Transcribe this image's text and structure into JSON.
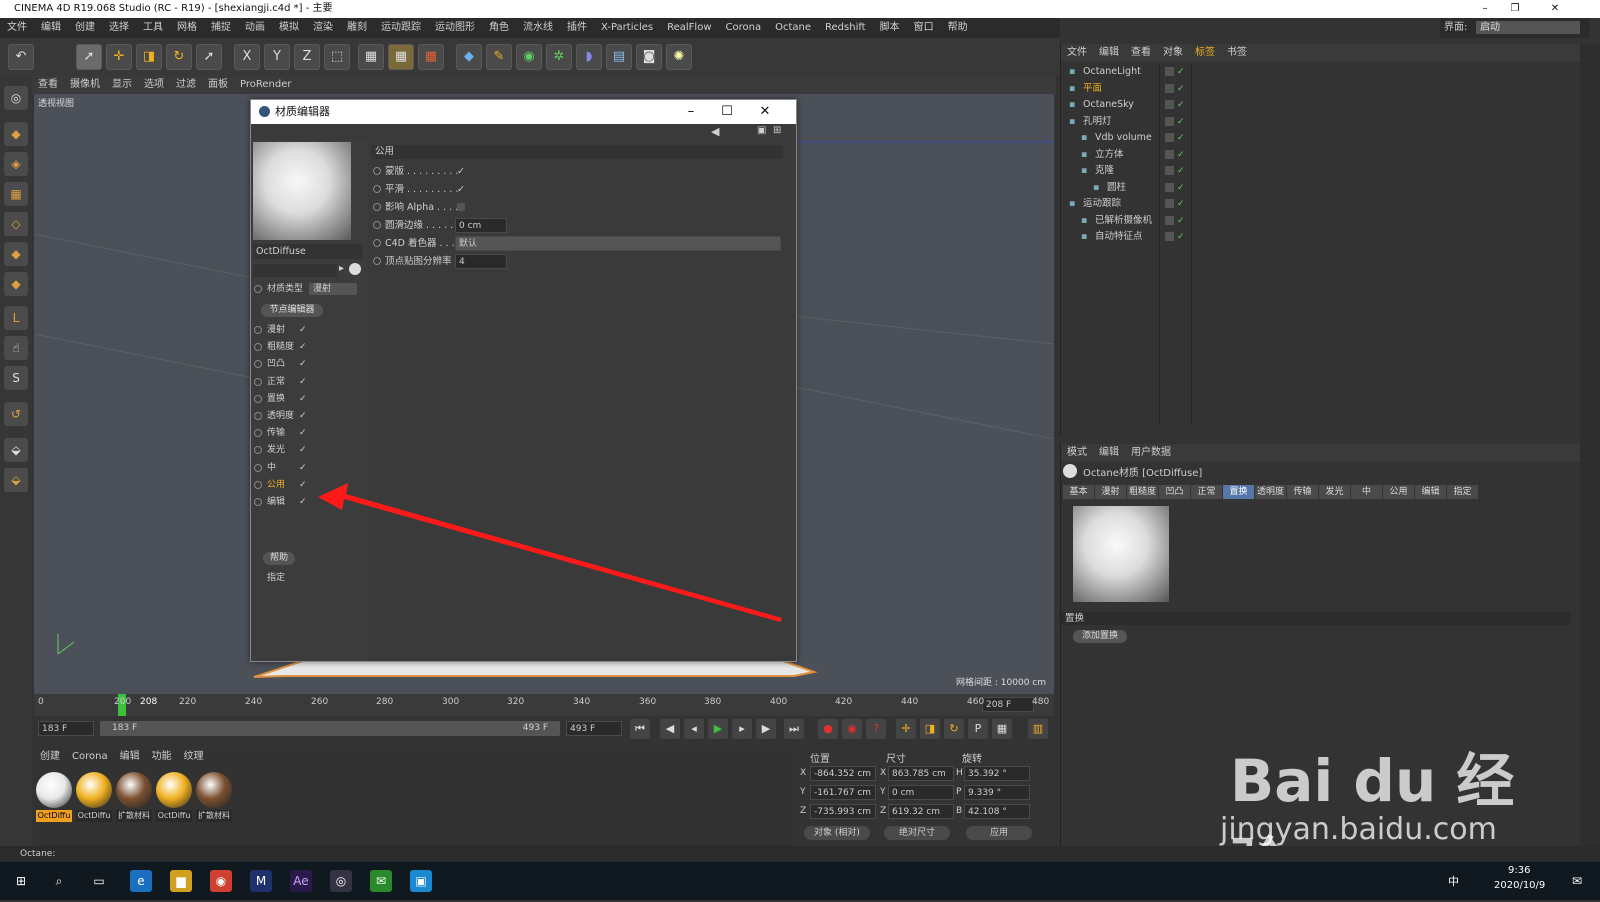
{
  "app": {
    "title": "CINEMA 4D R19.068 Studio (RC - R19) - [shexiangji.c4d *] - 主要",
    "interface_label": "界面:",
    "interface_value": "启动"
  },
  "menu": [
    "文件",
    "编辑",
    "创建",
    "选择",
    "工具",
    "网格",
    "捕捉",
    "动画",
    "模拟",
    "渲染",
    "雕刻",
    "运动跟踪",
    "运动图形",
    "角色",
    "流水线",
    "插件",
    "X-Particles",
    "RealFlow",
    "Corona",
    "Octane",
    "Redshift",
    "脚本",
    "窗口",
    "帮助"
  ],
  "toolbar_icons": [
    "undo-icon",
    "select-icon",
    "move-icon",
    "scale-icon",
    "rotate-icon",
    "live-select-icon",
    "x-axis-icon",
    "y-axis-icon",
    "z-axis-icon",
    "coord-icon",
    "render-view-icon",
    "render-picture-icon",
    "render-settings-icon",
    "cube-icon",
    "pen-icon",
    "subdivide-icon",
    "array-icon",
    "deformer-icon",
    "floor-icon",
    "camera-icon",
    "light-icon"
  ],
  "toolbar_letters": {
    "x": "X",
    "y": "Y",
    "z": "Z"
  },
  "viewport": {
    "menu": [
      "查看",
      "摄像机",
      "显示",
      "选项",
      "过滤",
      "面板",
      "ProRender"
    ],
    "label": "透视视图",
    "grid_info": "网格间距 : 10000 cm"
  },
  "timeline": {
    "ticks": [
      "200",
      "208",
      "220",
      "240",
      "260",
      "280",
      "300",
      "320",
      "340",
      "360",
      "380",
      "400",
      "420",
      "440",
      "460",
      "480"
    ],
    "start_tick": "0",
    "current": "208",
    "end_field": "208 F",
    "start_field": "183 F",
    "range_start": "183 F",
    "range_end": "493 F",
    "max_field": "493 F"
  },
  "material_manager": {
    "menu": [
      "创建",
      "Corona",
      "编辑",
      "功能",
      "纹理"
    ],
    "materials": [
      {
        "name": "OctDiffu",
        "color": "#e8e8e8"
      },
      {
        "name": "OctDiffu",
        "color": "#f0b020"
      },
      {
        "name": "扩散材料",
        "color": "#7a5030"
      },
      {
        "name": "OctDiffu",
        "color": "#f0b020"
      },
      {
        "name": "扩散材料",
        "color": "#7a5030"
      }
    ]
  },
  "coordinates": {
    "headers": [
      "位置",
      "尺寸",
      "旋转"
    ],
    "rows": [
      {
        "axis": "X",
        "pos": "-864.352 cm",
        "saxis": "X",
        "size": "863.785 cm",
        "raxis": "H",
        "rot": "35.392 °"
      },
      {
        "axis": "Y",
        "pos": "-161.767 cm",
        "saxis": "Y",
        "size": "0 cm",
        "raxis": "P",
        "rot": "9.339 °"
      },
      {
        "axis": "Z",
        "pos": "-735.993 cm",
        "saxis": "Z",
        "size": "619.32 cm",
        "raxis": "B",
        "rot": "42.108 °"
      }
    ],
    "mode1": "对象 (相对)",
    "mode2": "绝对尺寸",
    "apply": "应用"
  },
  "object_manager": {
    "menu": [
      "文件",
      "编辑",
      "查看",
      "对象",
      "标签",
      "书签"
    ],
    "rows": [
      {
        "name": "OctaneLight",
        "indent": 0
      },
      {
        "name": "平面",
        "indent": 0
      },
      {
        "name": "OctaneSky",
        "indent": 0
      },
      {
        "name": "孔明灯",
        "indent": 0
      },
      {
        "name": "Vdb volume",
        "indent": 1
      },
      {
        "name": "立方体",
        "indent": 1
      },
      {
        "name": "克隆",
        "indent": 1
      },
      {
        "name": "圆柱",
        "indent": 2
      },
      {
        "name": "运动跟踪",
        "indent": 0
      },
      {
        "name": "已解析摄像机",
        "indent": 1
      },
      {
        "name": "自动特征点",
        "indent": 1
      }
    ]
  },
  "attributes": {
    "menu": [
      "模式",
      "编辑",
      "用户数据"
    ],
    "title": "Octane材质 [OctDiffuse]",
    "tabs": [
      "基本",
      "漫射",
      "粗糙度",
      "凹凸",
      "正常",
      "置换",
      "透明度",
      "传输",
      "发光",
      "中",
      "公用",
      "编辑",
      "指定"
    ],
    "active_tab": "置换",
    "section": "置换",
    "add_button": "添加置换"
  },
  "dialog": {
    "title": "材质编辑器",
    "material_name": "OctDiffuse",
    "material_type_label": "材质类型",
    "material_type_value": "漫射",
    "node_editor": "节点编辑器",
    "channels": [
      {
        "label": "漫射",
        "check": "✓"
      },
      {
        "label": "粗糙度",
        "check": "✓"
      },
      {
        "label": "凹凸",
        "check": "✓"
      },
      {
        "label": "正常",
        "check": "✓"
      },
      {
        "label": "置换",
        "check": "✓"
      },
      {
        "label": "透明度",
        "check": "✓"
      },
      {
        "label": "传输",
        "check": "✓"
      },
      {
        "label": "发光",
        "check": "✓"
      },
      {
        "label": "中",
        "check": "✓"
      },
      {
        "label": "公用",
        "check": "✓"
      },
      {
        "label": "编辑",
        "check": "✓"
      }
    ],
    "help_button": "帮助",
    "assign_label": "指定",
    "section": "公用",
    "props": [
      {
        "label": "蒙版 . . . . . . . . .",
        "value": "✓"
      },
      {
        "label": "平滑 . . . . . . . . .",
        "value": "✓"
      },
      {
        "label": "影响 Alpha . . . .",
        "value": ""
      },
      {
        "label": "圆滑边缘 . . . . .",
        "value": "0 cm"
      },
      {
        "label": "C4D 着色器 . . . .",
        "value": "默认"
      },
      {
        "label": "顶点贴图分辨率",
        "value": "4"
      }
    ]
  },
  "statusbar": "Octane:",
  "clock": {
    "time": "9:36",
    "date": "2020/10/9"
  },
  "tray": {
    "ime": "中"
  },
  "watermark": {
    "brand": "Bai du 经验",
    "url": "jingyan.baidu.com"
  },
  "colors": {
    "accent": "#5577aa",
    "arrow": "#ff1a1a",
    "timeline_marker": "#3cc13c"
  }
}
